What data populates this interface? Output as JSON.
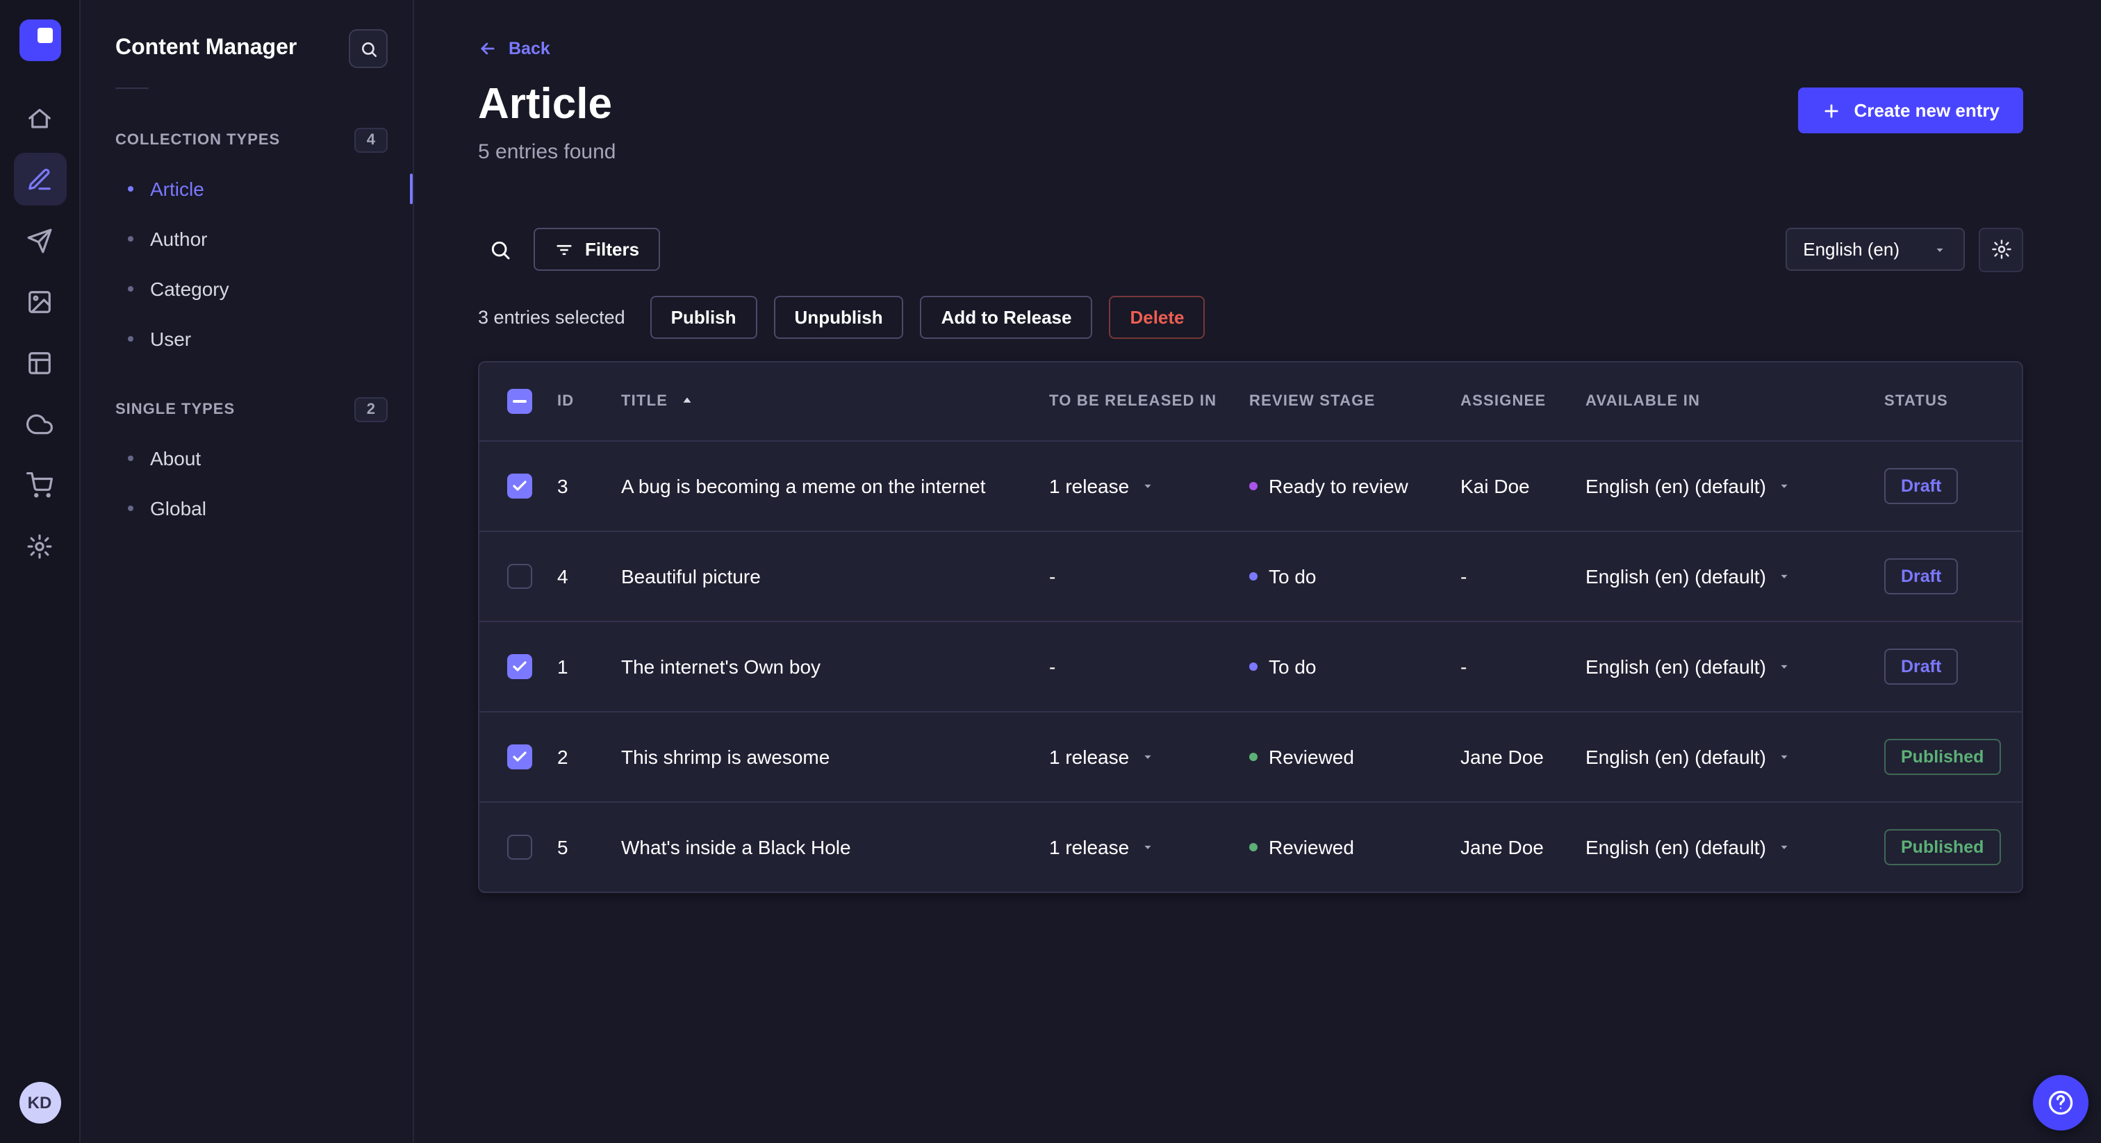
{
  "colors": {
    "accent": "#4945ff",
    "link": "#7b79ff",
    "success": "#5cb176",
    "danger": "#ee5e52",
    "stage_todo_dot": "#7b79ff",
    "stage_ready_dot": "#ab55e8",
    "stage_reviewed_dot": "#5cb176",
    "app_background": "#181826",
    "surface": "#212134"
  },
  "mini_sidebar": {
    "icons": [
      "strapi-logo",
      "home",
      "content-manager",
      "releases",
      "media-library",
      "content-type-builder",
      "deploy",
      "marketplace",
      "settings"
    ],
    "active_icon": "content-manager",
    "avatar_initials": "KD"
  },
  "sidebar": {
    "title": "Content Manager",
    "search_icon": "search-icon",
    "sections": [
      {
        "label": "COLLECTION TYPES",
        "badge": "4",
        "items": [
          {
            "label": "Article",
            "active": true
          },
          {
            "label": "Author",
            "active": false
          },
          {
            "label": "Category",
            "active": false
          },
          {
            "label": "User",
            "active": false
          }
        ]
      },
      {
        "label": "SINGLE TYPES",
        "badge": "2",
        "items": [
          {
            "label": "About",
            "active": false
          },
          {
            "label": "Global",
            "active": false
          }
        ]
      }
    ]
  },
  "header": {
    "back_label": "Back",
    "title": "Article",
    "subtitle": "5 entries found",
    "create_button_label": "Create new entry"
  },
  "toolbar": {
    "search_icon": "search-icon",
    "filters_label": "Filters",
    "locale_value": "English (en)",
    "settings_icon": "gear-icon"
  },
  "selection": {
    "summary": "3 entries selected",
    "publish_label": "Publish",
    "unpublish_label": "Unpublish",
    "add_to_release_label": "Add to Release",
    "delete_label": "Delete"
  },
  "table": {
    "columns": [
      "ID",
      "TITLE",
      "TO BE RELEASED IN",
      "REVIEW STAGE",
      "ASSIGNEE",
      "AVAILABLE IN",
      "STATUS"
    ],
    "sorted_column": "TITLE",
    "sort_direction": "asc",
    "rows": [
      {
        "checked": true,
        "id": "3",
        "title": "A bug is becoming a meme on the internet",
        "to_be_released_in": "1 release",
        "review_stage": "Ready to review",
        "assignee": "Kai Doe",
        "available_in": "English (en) (default)",
        "status": "Draft"
      },
      {
        "checked": false,
        "id": "4",
        "title": "Beautiful picture",
        "to_be_released_in": "-",
        "review_stage": "To do",
        "assignee": "-",
        "available_in": "English (en) (default)",
        "status": "Draft"
      },
      {
        "checked": true,
        "id": "1",
        "title": "The internet's Own boy",
        "to_be_released_in": "-",
        "review_stage": "To do",
        "assignee": "-",
        "available_in": "English (en) (default)",
        "status": "Draft"
      },
      {
        "checked": true,
        "id": "2",
        "title": "This shrimp is awesome",
        "to_be_released_in": "1 release",
        "review_stage": "Reviewed",
        "assignee": "Jane Doe",
        "available_in": "English (en) (default)",
        "status": "Published"
      },
      {
        "checked": false,
        "id": "5",
        "title": "What's inside a Black Hole",
        "to_be_released_in": "1 release",
        "review_stage": "Reviewed",
        "assignee": "Jane Doe",
        "available_in": "English (en) (default)",
        "status": "Published"
      }
    ]
  },
  "help": {
    "icon": "question-mark-circle-icon"
  }
}
